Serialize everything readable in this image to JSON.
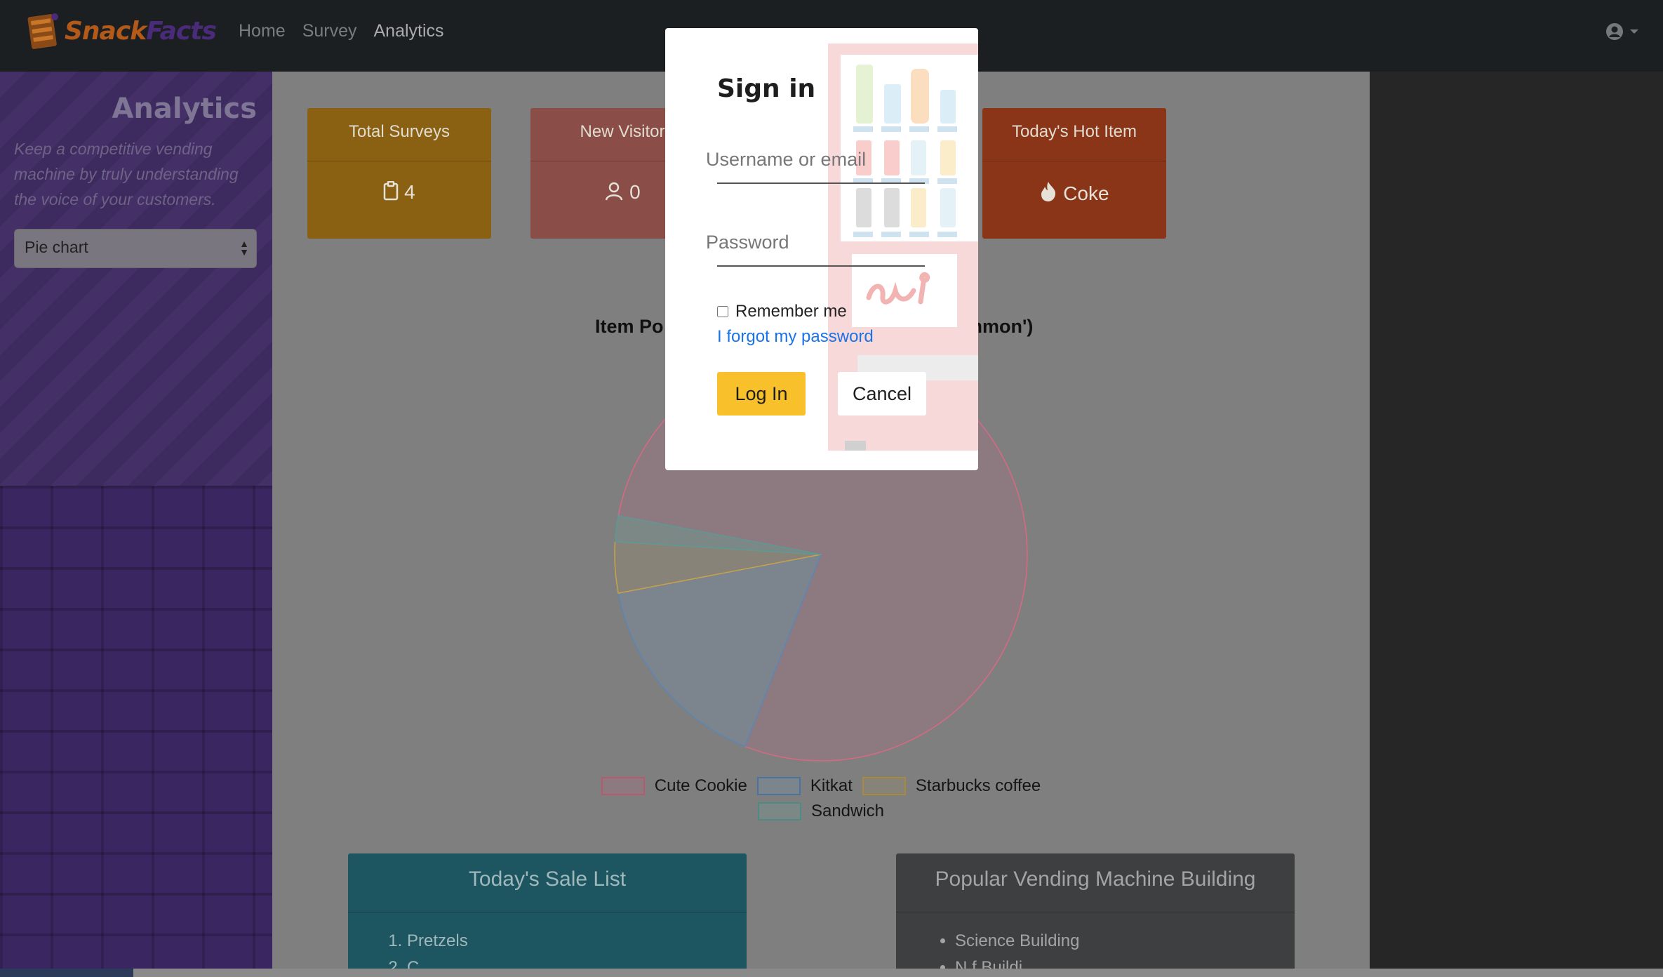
{
  "brand": {
    "part1": "Snack",
    "part2": "Facts"
  },
  "nav": {
    "items": [
      "Home",
      "Survey",
      "Analytics"
    ],
    "active": "Analytics"
  },
  "sidebar": {
    "title": "Analytics",
    "description": "Keep a competitive vending machine by truly understanding the voice of your customers.",
    "chart_type_selected": "Pie chart"
  },
  "cards": [
    {
      "title": "Total Surveys",
      "value": "4",
      "icon": "clipboard-icon",
      "color": "#F0A818"
    },
    {
      "title": "New Visitor",
      "value": "0",
      "icon": "user-icon",
      "color": "#D35D56"
    },
    {
      "title": "Today's Hot Item",
      "value": "Coke",
      "icon": "fire-icon",
      "color": "#D0431E"
    }
  ],
  "chart": {
    "title_left": "Item Po",
    "title_right": "mmon')"
  },
  "chart_data": {
    "type": "pie",
    "title": "Item Po... ...mmon')",
    "categories": [
      "Cute Cookie",
      "Kitkat",
      "Starbucks coffee",
      "Sandwich"
    ],
    "values": [
      78,
      16,
      4,
      2
    ],
    "colors": [
      "#d76a82",
      "#5a86b5",
      "#c9a24a",
      "#5a9a96"
    ],
    "legend": "bottom"
  },
  "panels": {
    "sale_list": {
      "title": "Today's Sale List",
      "items": [
        "Pretzels",
        "C"
      ]
    },
    "popular_building": {
      "title": "Popular Vending Machine Building",
      "items": [
        "Science Building",
        "N  f Buildi"
      ]
    }
  },
  "modal": {
    "title": "Sign in",
    "username_placeholder": "Username or email",
    "password_placeholder": "Password",
    "remember_label": "Remember me",
    "forgot_link": "I forgot my password",
    "login_button": "Log In",
    "cancel_button": "Cancel"
  }
}
